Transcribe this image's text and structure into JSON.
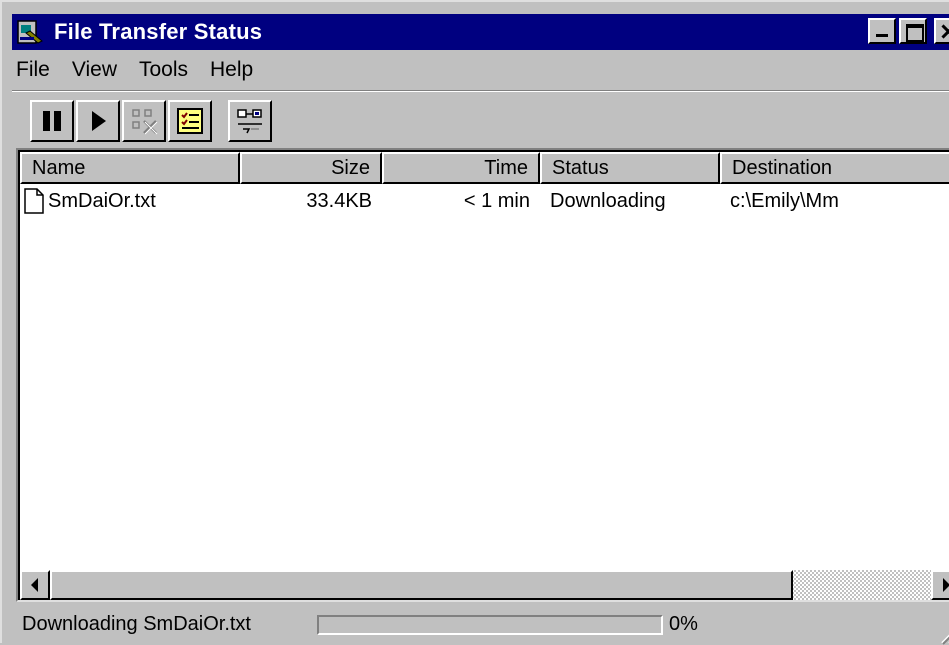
{
  "window": {
    "title": "File Transfer Status"
  },
  "menu": [
    "File",
    "View",
    "Tools",
    "Help"
  ],
  "toolbar": {
    "buttons": [
      "pause-icon",
      "play-icon",
      "cancel-transfer-icon",
      "checklist-icon",
      "network-transfer-icon"
    ]
  },
  "list": {
    "columns": [
      "Name",
      "Size",
      "Time",
      "Status",
      "Destination"
    ],
    "rows": [
      {
        "name": "SmDaiOr.txt",
        "size": "33.4KB",
        "time": "< 1 min",
        "status": "Downloading",
        "destination": "c:\\Emily\\Mm"
      }
    ]
  },
  "status": {
    "text": "Downloading SmDaiOr.txt",
    "progress_percent": 0,
    "percent_label": "0%"
  },
  "colors": {
    "title_bar": "#000080",
    "face": "#c0c0c0"
  }
}
